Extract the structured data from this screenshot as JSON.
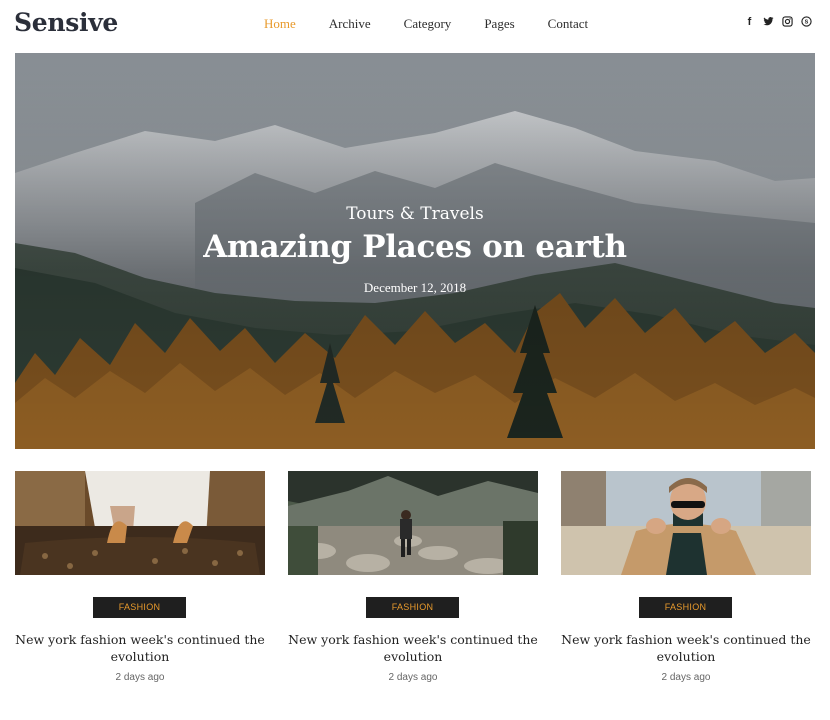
{
  "brand": {
    "logo": "Sensive"
  },
  "nav": [
    {
      "label": "Home",
      "active": true
    },
    {
      "label": "Archive",
      "active": false
    },
    {
      "label": "Category",
      "active": false
    },
    {
      "label": "Pages",
      "active": false
    },
    {
      "label": "Contact",
      "active": false
    }
  ],
  "social": [
    {
      "icon": "facebook-icon",
      "glyph": "f"
    },
    {
      "icon": "twitter-icon",
      "glyph": "❀"
    },
    {
      "icon": "instagram-icon",
      "glyph": "▣"
    },
    {
      "icon": "skype-icon",
      "glyph": "S"
    }
  ],
  "hero": {
    "category": "Tours & Travels",
    "title": "Amazing Places on earth",
    "date": "December 12, 2018"
  },
  "cards": [
    {
      "badge": "FASHION",
      "title": "New york fashion week's continued the evolution",
      "meta": "2 days ago",
      "image": "handbag-photo"
    },
    {
      "badge": "FASHION",
      "title": "New york fashion week's continued the evolution",
      "meta": "2 days ago",
      "image": "hiker-photo"
    },
    {
      "badge": "FASHION",
      "title": "New york fashion week's continued the evolution",
      "meta": "2 days ago",
      "image": "man-sunglasses-photo"
    }
  ],
  "colors": {
    "accent": "#e89a2c",
    "badge_bg": "#1f1f1f",
    "logo": "#2b2f3a"
  }
}
